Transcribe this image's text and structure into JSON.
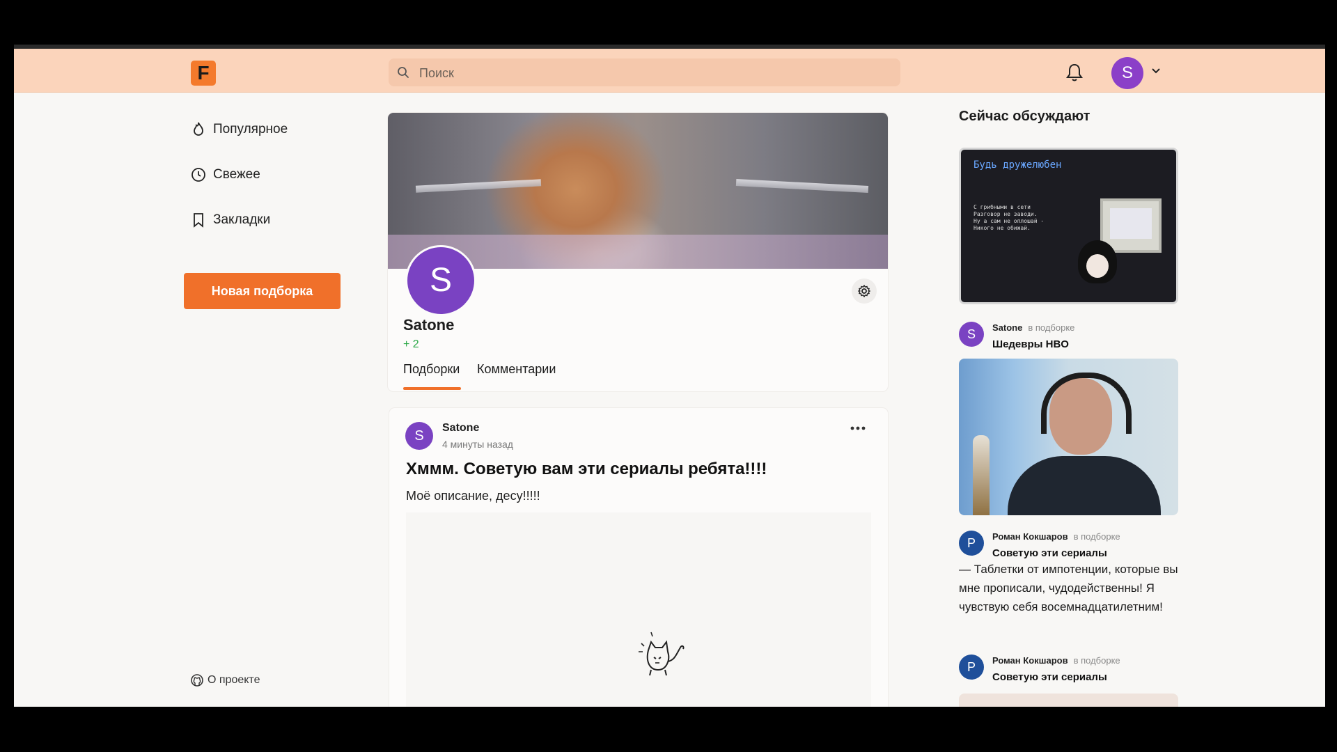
{
  "header": {
    "logo_letter": "F",
    "search_placeholder": "Поиск",
    "user_initial": "S"
  },
  "nav": {
    "items": [
      {
        "label": "Популярное",
        "icon": "flame-icon"
      },
      {
        "label": "Свежее",
        "icon": "clock-icon"
      },
      {
        "label": "Закладки",
        "icon": "bookmark-icon"
      }
    ],
    "new_collection_button": "Новая подборка",
    "about_link": "О проекте"
  },
  "profile": {
    "avatar_initial": "S",
    "name": "Satone",
    "rating": "+ 2",
    "tabs": [
      "Подборки",
      "Комментарии"
    ],
    "active_tab": 0
  },
  "post": {
    "author_initial": "S",
    "author": "Satone",
    "time": "4 минуты назад",
    "title": "Хммм. Советую вам эти сериалы ребята!!!!",
    "description": "Моё описание, десу!!!!!"
  },
  "sidebar": {
    "title": "Сейчас обсуждают",
    "thumb1": {
      "heading": "Будь дружелюбен",
      "lines": [
        "С грибными в сети",
        "Разговор не заводи.",
        "Ну а сам не оплошай -",
        "Никого не обижай."
      ]
    },
    "entries": [
      {
        "initial": "S",
        "color": "#7a42c2",
        "author": "Satone",
        "in": "в подборке",
        "collection": "Шедевры HBO"
      },
      {
        "initial": "Р",
        "color": "#1f4f9a",
        "author": "Роман Кокшаров",
        "in": "в подборке",
        "collection": "Советую эти сериалы",
        "comment": "— Таблетки от импотенции, которые вы мне прописали, чудодейственны! Я чувствую себя восемнадцатилетним!"
      },
      {
        "initial": "Р",
        "color": "#1f4f9a",
        "author": "Роман Кокшаров",
        "in": "в подборке",
        "collection": "Советую эти сериалы"
      }
    ]
  }
}
